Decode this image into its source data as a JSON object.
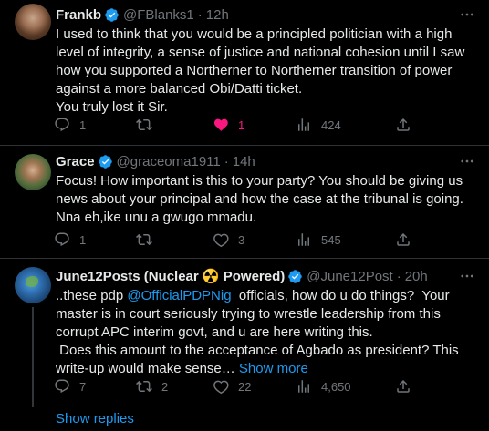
{
  "tweets": [
    {
      "name": "Frankb",
      "handle": "@FBlanks1",
      "time": "12h",
      "text": "I used to think that you would be a principled politician with a high level of integrity, a sense of justice and national cohesion until I saw how you supported a Northerner to Northerner transition of power against a more balanced Obi/Datti ticket.\nYou truly lost it Sir.",
      "replies": "1",
      "retweets": "",
      "likes": "1",
      "views": "424",
      "liked": true
    },
    {
      "name": "Grace",
      "handle": "@graceoma1911",
      "time": "14h",
      "text": "Focus! How important is this to your party? You should be giving us news about your principal and how the case at the tribunal is going. Nna eh,ike unu a gwugo mmadu.",
      "replies": "1",
      "retweets": "",
      "likes": "3",
      "views": "545",
      "liked": false
    },
    {
      "name": "June12Posts (Nuclear ☢️ Powered)",
      "handle": "@June12Post",
      "time": "20h",
      "text_before": "..these pdp ",
      "mention": "@OfficialPDPNig",
      "text_after": "  officials, how do u do things?  Your master is in court seriously trying to wrestle leadership from this corrupt APC interim govt, and u are here writing this.\n Does this amount to the acceptance of Agbado as president? This write-up would make sense… ",
      "show_more": "Show more",
      "replies": "7",
      "retweets": "2",
      "likes": "22",
      "views": "4,650",
      "liked": false
    }
  ],
  "show_replies": "Show replies",
  "colors": {
    "accent": "#1d9bf0",
    "like": "#f91880",
    "muted": "#71767b",
    "text": "#e7e9ea",
    "background": "#000000"
  }
}
